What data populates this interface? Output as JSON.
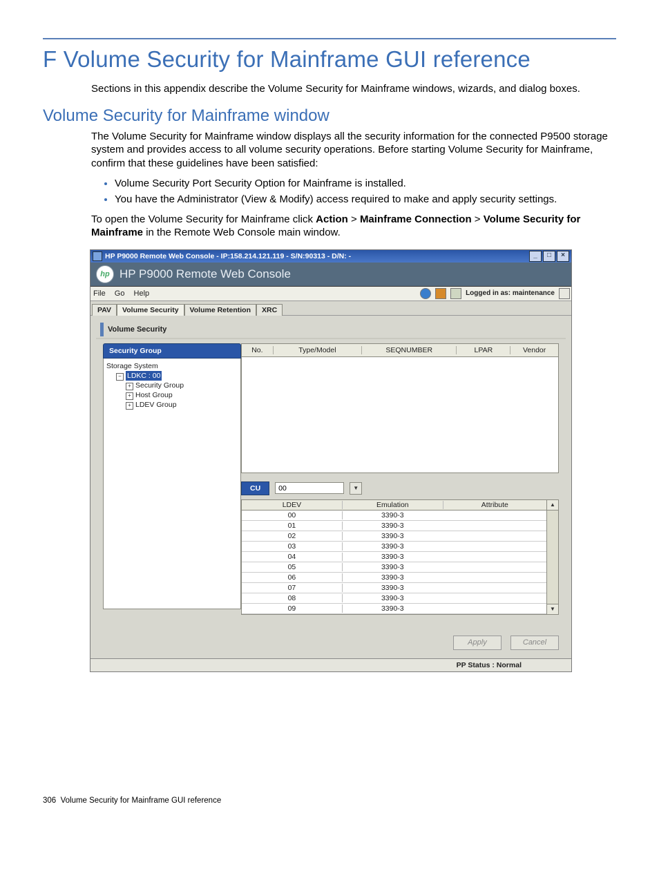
{
  "doc": {
    "title": "F Volume Security for Mainframe GUI reference",
    "intro": "Sections in this appendix describe the Volume Security for Mainframe windows, wizards, and dialog boxes.",
    "section": "Volume Security for Mainframe window",
    "para1": "The Volume Security for Mainframe window displays all the security information for the connected P9500 storage system and provides access to all volume security operations. Before starting Volume Security for Mainframe, confirm that these guidelines have been satisfied:",
    "bullet1": "Volume Security Port Security Option for Mainframe is installed.",
    "bullet2": "You have the Administrator (View & Modify) access required to make and apply security settings.",
    "para2a": "To open the Volume Security for Mainframe click ",
    "action": "Action",
    "gt1": " > ",
    "mfconn": "Mainframe Connection",
    "gt2": " > ",
    "vsfm": "Volume Security for Mainframe",
    "para2b": " in the Remote Web Console main window.",
    "page_footer_num": "306",
    "page_footer_text": "Volume Security for Mainframe GUI reference"
  },
  "win": {
    "title": "HP P9000 Remote Web Console - IP:158.214.121.119 - S/N:90313 - D/N: -",
    "brand": "HP P9000 Remote Web Console",
    "menus": {
      "file": "File",
      "go": "Go",
      "help": "Help"
    },
    "logged_in": "Logged in as: maintenance",
    "tabs": {
      "pav": "PAV",
      "vsec": "Volume Security",
      "vret": "Volume Retention",
      "xrc": "XRC"
    },
    "panel_title": "Volume Security",
    "left_tab": "Security Group",
    "tree": {
      "root": "Storage System",
      "ldkc": "LDKC : 00",
      "n1": "Security Group",
      "n2": "Host Group",
      "n3": "LDEV Group"
    },
    "grid": {
      "no": "No.",
      "typemodel": "Type/Model",
      "seqnum": "SEQNUMBER",
      "lpar": "LPAR",
      "vendor": "Vendor"
    },
    "cu": {
      "label": "CU",
      "value": "00"
    },
    "ldev": {
      "head": {
        "ldev": "LDEV",
        "emu": "Emulation",
        "attr": "Attribute"
      },
      "rows": [
        {
          "ldev": "00",
          "emu": "3390-3",
          "attr": ""
        },
        {
          "ldev": "01",
          "emu": "3390-3",
          "attr": ""
        },
        {
          "ldev": "02",
          "emu": "3390-3",
          "attr": ""
        },
        {
          "ldev": "03",
          "emu": "3390-3",
          "attr": ""
        },
        {
          "ldev": "04",
          "emu": "3390-3",
          "attr": ""
        },
        {
          "ldev": "05",
          "emu": "3390-3",
          "attr": ""
        },
        {
          "ldev": "06",
          "emu": "3390-3",
          "attr": ""
        },
        {
          "ldev": "07",
          "emu": "3390-3",
          "attr": ""
        },
        {
          "ldev": "08",
          "emu": "3390-3",
          "attr": ""
        },
        {
          "ldev": "09",
          "emu": "3390-3",
          "attr": ""
        }
      ]
    },
    "buttons": {
      "apply": "Apply",
      "cancel": "Cancel"
    },
    "status": "PP Status : Normal"
  }
}
